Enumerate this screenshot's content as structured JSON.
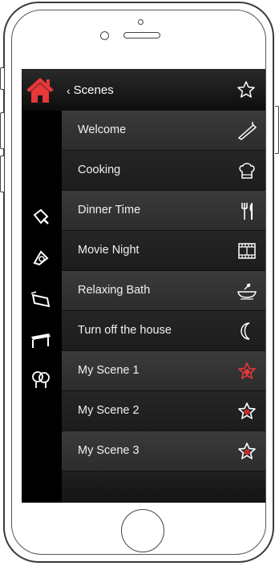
{
  "header": {
    "back_label": "Scenes"
  },
  "colors": {
    "accent": "#e8383a",
    "screen_bg": "#0a0a0a",
    "row_light": "#363636",
    "row_dark": "#222222",
    "text": "#f0f0f0"
  },
  "sidebar": {
    "icons": [
      "home-icon",
      "lighting-icon",
      "audio-icon",
      "shades-icon",
      "table-icon",
      "garden-icon"
    ]
  },
  "scenes": [
    {
      "label": "Welcome",
      "icon": "dimmer-icon"
    },
    {
      "label": "Cooking",
      "icon": "chef-hat-icon"
    },
    {
      "label": "Dinner Time",
      "icon": "fork-knife-icon"
    },
    {
      "label": "Movie Night",
      "icon": "film-icon"
    },
    {
      "label": "Relaxing Bath",
      "icon": "bath-icon"
    },
    {
      "label": "Turn off the house",
      "icon": "moon-icon"
    },
    {
      "label": "My Scene 1",
      "icon": "star-icon-active"
    },
    {
      "label": "My Scene 2",
      "icon": "star-icon"
    },
    {
      "label": "My Scene 3",
      "icon": "star-icon"
    }
  ]
}
